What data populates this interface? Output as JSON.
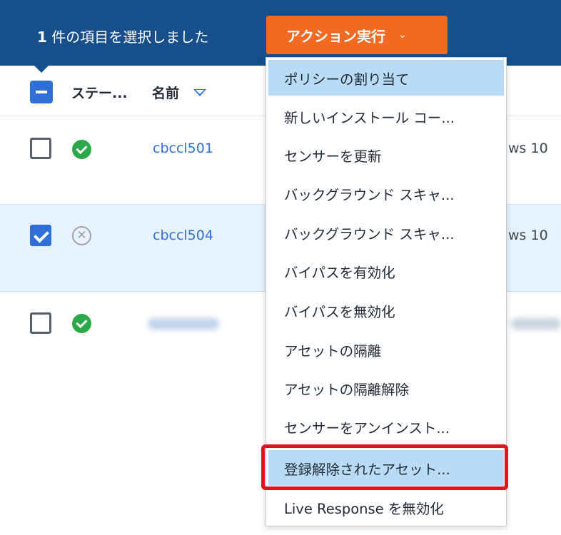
{
  "selection_bar": {
    "count": "1",
    "text": " 件の項目を選択しました",
    "action_button": "アクション実行",
    "action_chevron": "⌄"
  },
  "table": {
    "headers": {
      "status": "ステー...",
      "name": "名前"
    },
    "rows": [
      {
        "checked": false,
        "status": "ok",
        "name": "cbccl501",
        "os": "ws 10"
      },
      {
        "checked": true,
        "status": "removed",
        "name": "cbccl504",
        "os": "ws 10"
      },
      {
        "checked": false,
        "status": "ok",
        "name": "",
        "os": ""
      }
    ]
  },
  "menu": {
    "items": [
      "ポリシーの割り当て",
      "新しいインストール コー...",
      "センサーを更新",
      "バックグラウンド スキャ...",
      "バックグラウンド スキャ...",
      "バイパスを有効化",
      "バイパスを無効化",
      "アセットの隔離",
      "アセットの隔離解除",
      "センサーをアンインスト...",
      "登録解除されたアセット...",
      "Live Response を無効化"
    ]
  },
  "colors": {
    "topbar": "#174e8c",
    "action_button": "#f26a21",
    "highlight": "#b9dcf6",
    "focus_outline": "#e0141c",
    "link": "#2f6fd6",
    "ok_status": "#2aa84a"
  }
}
